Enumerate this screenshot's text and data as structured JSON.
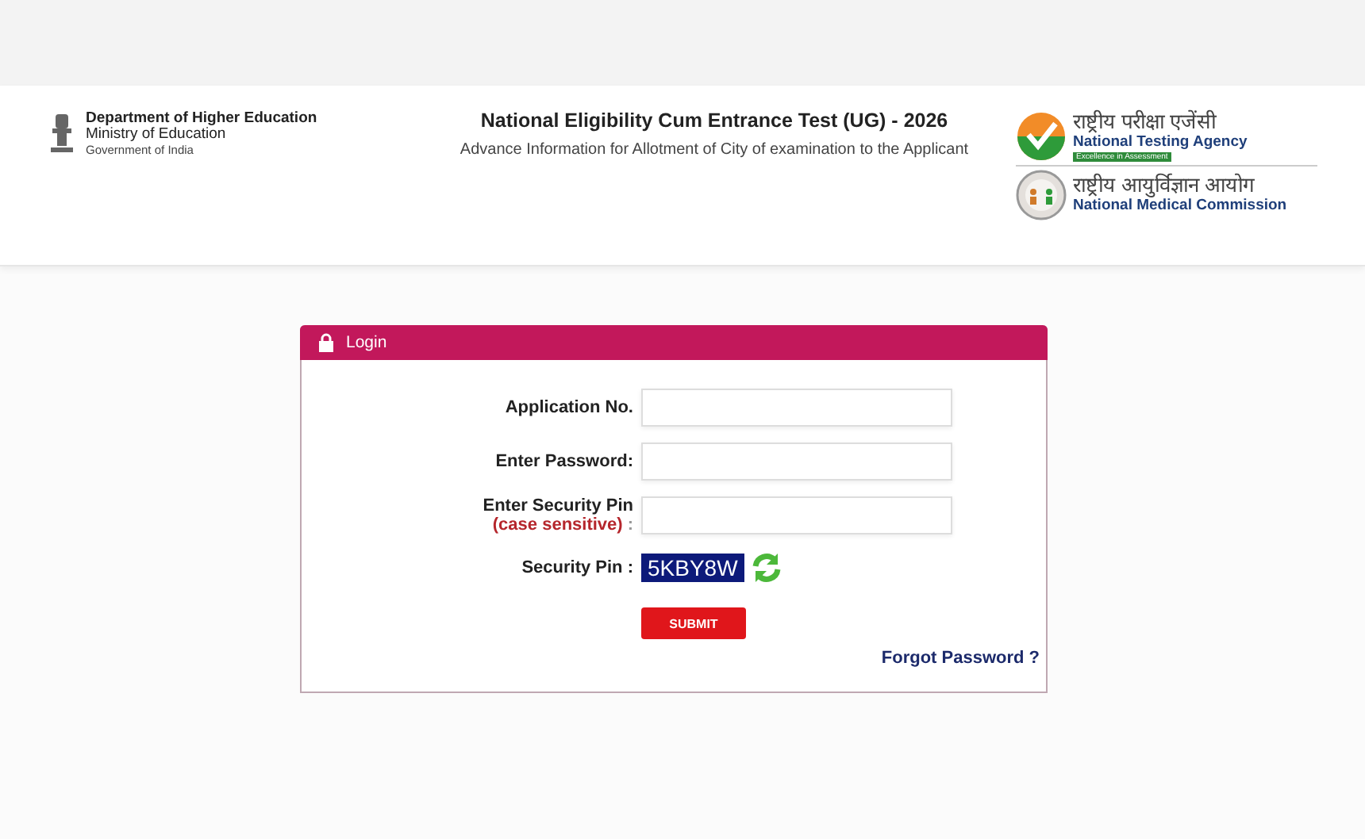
{
  "header": {
    "department": {
      "name": "Department of Higher Education",
      "ministry": "Ministry of Education",
      "government": "Government of India"
    },
    "title": "National Eligibility Cum Entrance Test (UG) - 2026",
    "subtitle": "Advance Information for Allotment of City of examination to the Applicant",
    "agencies": [
      {
        "kind": "nta",
        "native_name": "राष्ट्रीय परीक्षा एजेंसी",
        "name": "National Testing Agency",
        "tagline": "Excellence in Assessment"
      },
      {
        "kind": "nmc",
        "native_name": "राष्ट्रीय आयुर्विज्ञान आयोग",
        "name": "National Medical Commission"
      }
    ]
  },
  "login": {
    "title": "Login",
    "fields": [
      {
        "kind": "input",
        "label": "Application No."
      },
      {
        "kind": "input",
        "label": "Enter Password:"
      },
      {
        "kind": "input",
        "label": "Enter Security Pin",
        "note": "(case sensitive)",
        "separator": ":"
      },
      {
        "kind": "captcha",
        "label": "Security Pin :",
        "value": "5KBY8W"
      }
    ],
    "submit": "SUBMIT",
    "forgot_link": "Forgot Password ?"
  }
}
